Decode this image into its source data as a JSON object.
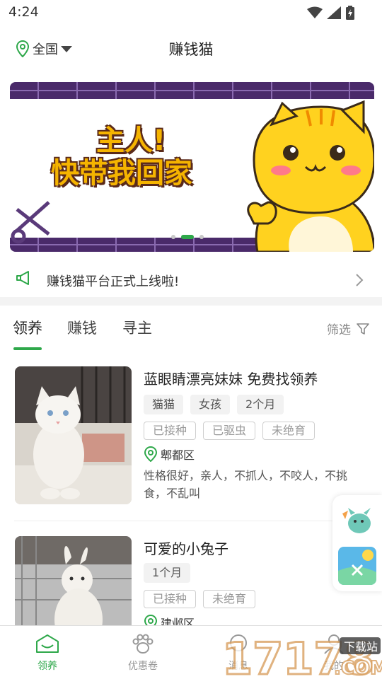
{
  "status_bar": {
    "time": "4:24"
  },
  "header": {
    "location": "全国",
    "title": "赚钱猫"
  },
  "banner": {
    "line1": "主人!",
    "line2": "快带我回家",
    "dots": 3,
    "active_dot": 1,
    "colors": {
      "frame": "#4a2a6a",
      "text": "#f5b400",
      "cat": "#ffd21f"
    }
  },
  "notice": {
    "text": "赚钱猫平台正式上线啦!"
  },
  "tabs": {
    "items": [
      "领养",
      "赚钱",
      "寻主"
    ],
    "active": "领养",
    "filter_label": "筛选"
  },
  "listings": [
    {
      "title": "蓝眼睛漂亮妹妹 免费找领养",
      "tags": [
        "猫猫",
        "女孩",
        "2个月"
      ],
      "status_tags": [
        "已接种",
        "已驱虫",
        "未绝育"
      ],
      "region": "郫都区",
      "description": "性格很好，亲人，不抓人，不咬人，不挑食，不乱叫"
    },
    {
      "title": "可爱的小兔子",
      "tags": [
        "1个月"
      ],
      "status_tags": [
        "已接种",
        "未绝育"
      ],
      "region": "建邺区"
    }
  ],
  "bottom_nav": {
    "items": [
      {
        "label": "领养",
        "icon": "home-icon"
      },
      {
        "label": "优惠卷",
        "icon": "paw-icon"
      },
      {
        "label": "消息",
        "icon": "message-icon"
      },
      {
        "label": "我的",
        "icon": "user-icon"
      }
    ],
    "active": "领养"
  },
  "watermark": {
    "text": "17178",
    "sub": "下载站",
    "domain": ".COM"
  },
  "colors": {
    "accent": "#2ea84a",
    "text": "#222222",
    "muted": "#999999"
  }
}
